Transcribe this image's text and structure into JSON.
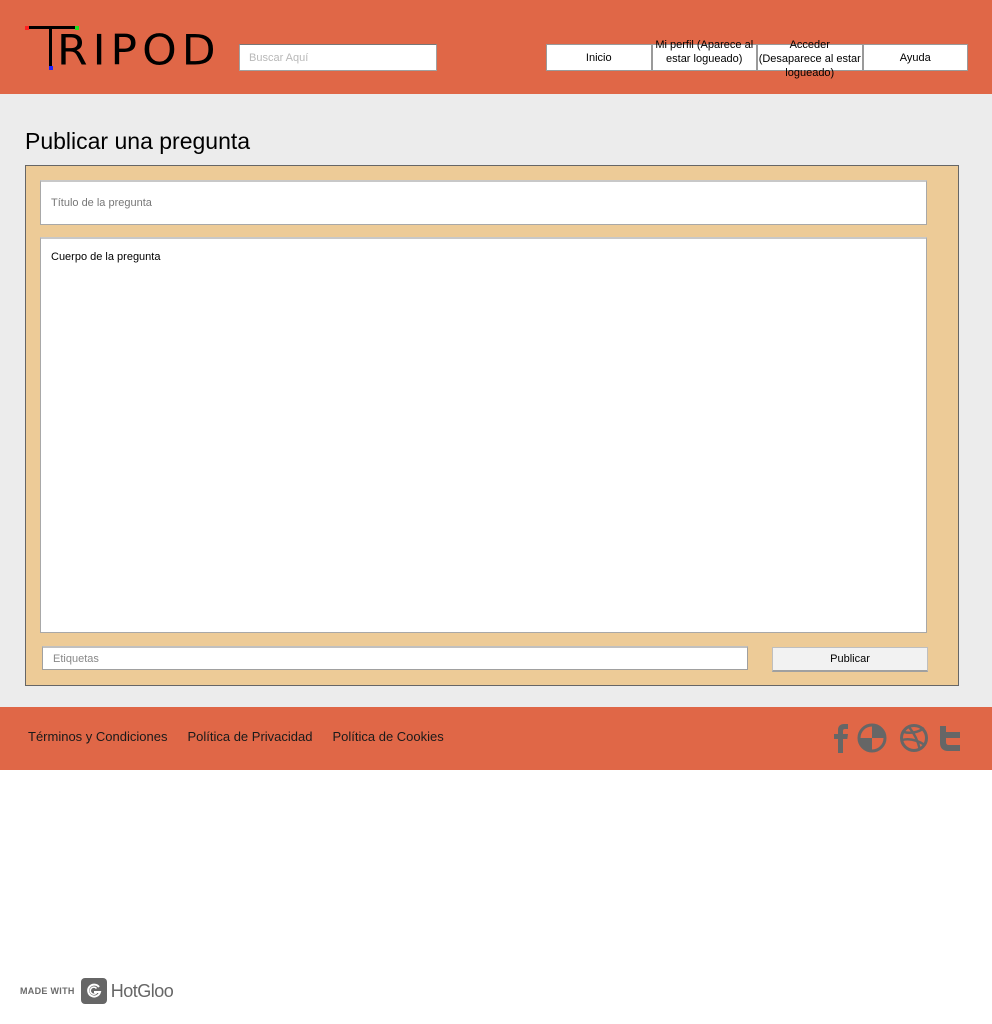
{
  "header": {
    "logo_text": "TRIPOD",
    "logo_rest": "RIPOD",
    "search_placeholder": "Buscar Aquí",
    "nav": [
      {
        "label": "Inicio"
      },
      {
        "label": "Mi perfil (Aparece al estar logueado)"
      },
      {
        "label": "Acceder (Desaparece al estar logueado)"
      },
      {
        "label": "Ayuda"
      }
    ]
  },
  "main": {
    "page_title": "Publicar una pregunta",
    "form": {
      "title_placeholder": "Título de la pregunta",
      "body_placeholder": "Cuerpo de la pregunta",
      "tags_placeholder": "Etiquetas",
      "publish_label": "Publicar"
    }
  },
  "footer": {
    "links": [
      {
        "label": "Términos y Condiciones"
      },
      {
        "label": "Política de Privacidad"
      },
      {
        "label": "Política de Cookies"
      }
    ],
    "social_icons": [
      "facebook-icon",
      "pie-chart-icon",
      "dribbble-icon",
      "twitter-icon"
    ]
  },
  "badge": {
    "made_with": "MADE WITH",
    "brand": "HotGloo"
  },
  "colors": {
    "header_bg": "#e06747",
    "content_bg": "#ececec",
    "panel_bg": "#edcb97",
    "icon": "#666666"
  }
}
